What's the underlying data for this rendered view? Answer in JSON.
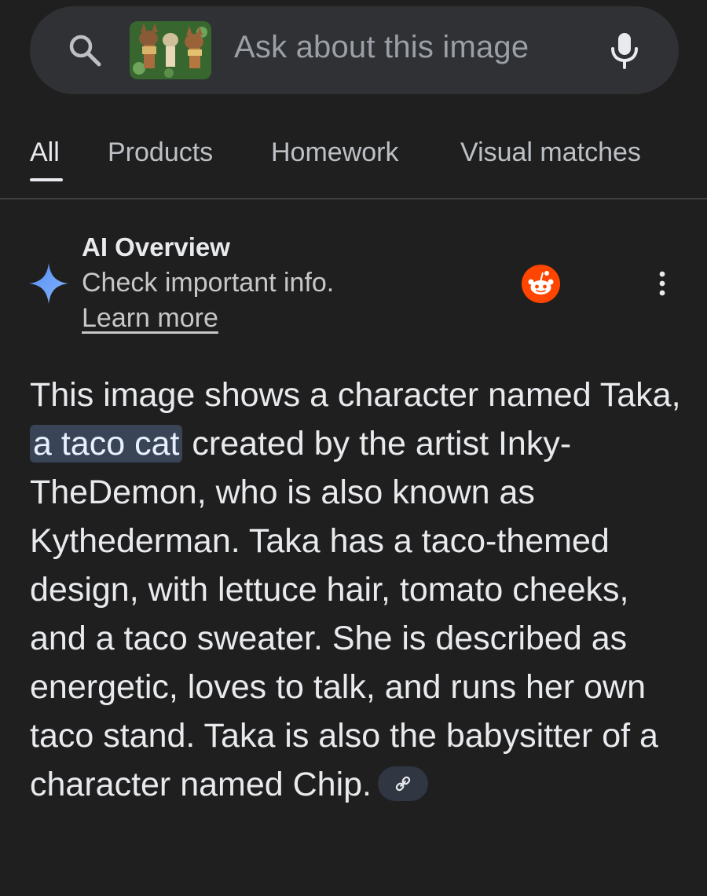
{
  "search": {
    "placeholder": "Ask about this image"
  },
  "tabs": [
    {
      "label": "All",
      "active": true
    },
    {
      "label": "Products",
      "active": false
    },
    {
      "label": "Homework",
      "active": false
    },
    {
      "label": "Visual matches",
      "active": false
    }
  ],
  "ai_overview": {
    "title": "AI Overview",
    "subtitle": "Check important info.",
    "learn_more": "Learn more",
    "source_icon": "reddit-icon"
  },
  "body": {
    "part1": "This image shows a character named Taka, ",
    "highlight": "a taco cat",
    "part2": " created by the artist Inky-TheDemon, who is also known as Kythederman. Taka has a taco-themed design, with lettuce hair, tomato cheeks, and a taco sweater. She is described as energetic, loves to talk, and runs her own taco stand. Taka is also the babysitter of a character named Chip."
  },
  "colors": {
    "background": "#1f1f1f",
    "search_bar": "#303134",
    "highlight": "#394457",
    "sparkle": "#4f8ef7",
    "reddit": "#ff4500"
  },
  "icons": [
    "search-icon",
    "image-thumbnail",
    "mic-icon",
    "sparkle-icon",
    "reddit-icon",
    "more-vert-icon",
    "link-icon"
  ]
}
